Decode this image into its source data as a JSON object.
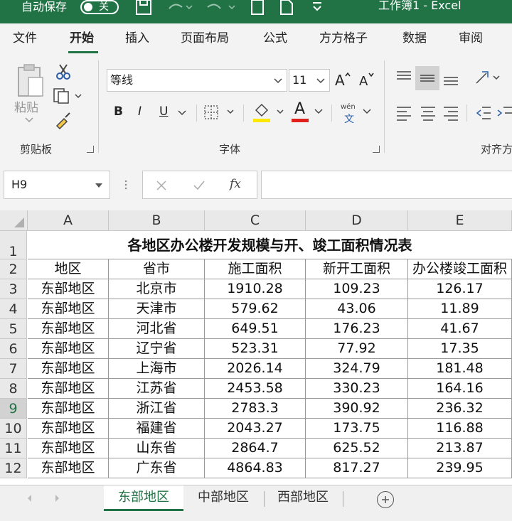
{
  "titlebar": {
    "autosave_label": "自动保存",
    "toggle_state": "关",
    "filename": "工作簿1  -  Excel"
  },
  "menu": {
    "tabs": [
      "文件",
      "开始",
      "插入",
      "页面布局",
      "公式",
      "方方格子",
      "数据",
      "审阅"
    ],
    "active": "开始"
  },
  "ribbon": {
    "clipboard": {
      "paste_label": "粘贴",
      "group_label": "剪贴板"
    },
    "font": {
      "font_name": "等线",
      "font_size": "11",
      "bold": "B",
      "italic": "I",
      "underline": "U",
      "font_color_letter": "A",
      "phonetic_top": "wén",
      "phonetic_bottom": "文",
      "group_label": "字体",
      "highlight_color": "#ffe800",
      "font_color": "#e0201b"
    },
    "alignment": {
      "group_label": "对齐方"
    }
  },
  "formula_bar": {
    "name_box": "H9",
    "fx_label": "fx",
    "formula": ""
  },
  "sheet": {
    "columns": [
      "A",
      "B",
      "C",
      "D",
      "E"
    ],
    "title": "各地区办公楼开发规模与开、竣工面积情况表",
    "headers": [
      "地区",
      "省市",
      "施工面积",
      "新开工面积",
      "办公楼竣工面积"
    ],
    "rows": [
      [
        "东部地区",
        "北京市",
        "1910.28",
        "109.23",
        "126.17"
      ],
      [
        "东部地区",
        "天津市",
        "579.62",
        "43.06",
        "11.89"
      ],
      [
        "东部地区",
        "河北省",
        "649.51",
        "176.23",
        "41.67"
      ],
      [
        "东部地区",
        "辽宁省",
        "523.31",
        "77.92",
        "17.35"
      ],
      [
        "东部地区",
        "上海市",
        "2026.14",
        "324.79",
        "181.48"
      ],
      [
        "东部地区",
        "江苏省",
        "2453.58",
        "330.23",
        "164.16"
      ],
      [
        "东部地区",
        "浙江省",
        "2783.3",
        "390.92",
        "236.32"
      ],
      [
        "东部地区",
        "福建省",
        "2043.27",
        "173.75",
        "116.88"
      ],
      [
        "东部地区",
        "山东省",
        "2864.7",
        "625.52",
        "213.87"
      ],
      [
        "东部地区",
        "广东省",
        "4864.83",
        "817.27",
        "239.95"
      ]
    ],
    "row_numbers": [
      "1",
      "2",
      "3",
      "4",
      "5",
      "6",
      "7",
      "8",
      "9",
      "10",
      "11",
      "12"
    ],
    "selected_row": "9"
  },
  "sheet_tabs": {
    "tabs": [
      "东部地区",
      "中部地区",
      "西部地区"
    ],
    "active": "东部地区"
  },
  "colors": {
    "accent": "#217346"
  }
}
